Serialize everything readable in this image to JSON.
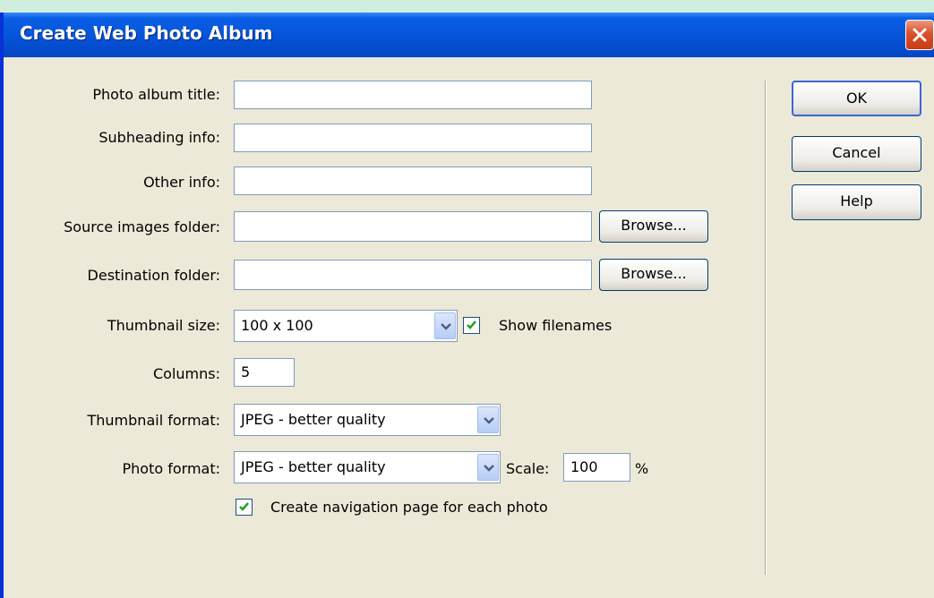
{
  "window": {
    "title": "Create Web Photo Album"
  },
  "form": {
    "album_title_label": "Photo album title:",
    "album_title_value": "",
    "subheading_label": "Subheading info:",
    "subheading_value": "",
    "other_info_label": "Other info:",
    "other_info_value": "",
    "source_folder_label": "Source images folder:",
    "source_folder_value": "",
    "source_browse": "Browse...",
    "dest_folder_label": "Destination folder:",
    "dest_folder_value": "",
    "dest_browse": "Browse...",
    "thumb_size_label": "Thumbnail size:",
    "thumb_size_value": "100 x 100",
    "show_filenames_label": "Show filenames",
    "show_filenames_checked": true,
    "columns_label": "Columns:",
    "columns_value": "5",
    "thumb_format_label": "Thumbnail format:",
    "thumb_format_value": "JPEG - better quality",
    "photo_format_label": "Photo format:",
    "photo_format_value": "JPEG - better quality",
    "scale_label": "Scale:",
    "scale_value": "100",
    "scale_unit": "%",
    "nav_page_label": "Create navigation page for each photo",
    "nav_page_checked": true
  },
  "buttons": {
    "ok": "OK",
    "cancel": "Cancel",
    "help": "Help"
  },
  "colors": {
    "titlebar": "#0653d8",
    "dialog_bg": "#ece9d8",
    "check_green": "#21a121",
    "close_red": "#d9502b"
  }
}
